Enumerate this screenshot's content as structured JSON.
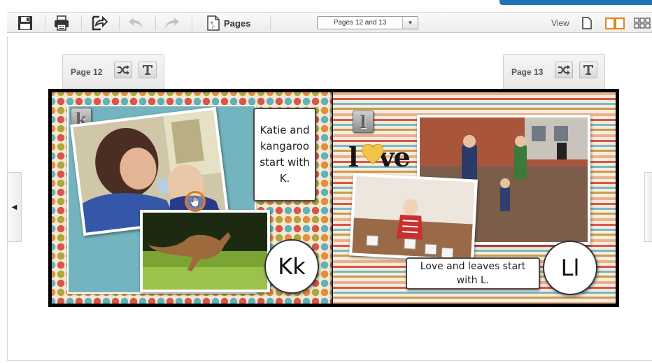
{
  "toolbar": {
    "pages_button_label": "Pages",
    "page_select_value": "Pages 12 and 13",
    "view_label": "View",
    "icons": [
      "save-icon",
      "print-icon",
      "share-icon",
      "undo-icon",
      "redo-icon",
      "pages-icon",
      "single-page-icon",
      "book-view-icon",
      "grid-view-icon"
    ]
  },
  "left_page": {
    "tab_label": "Page 12",
    "letter_tile": "k",
    "caption": "Katie and kangaroo start with K.",
    "badge": "Kk"
  },
  "right_page": {
    "tab_label": "Page 13",
    "letter_tile": "l",
    "title_word_first": "l",
    "title_word_rest": "ve",
    "caption": "Love and leaves start with L.",
    "badge": "Ll"
  },
  "nav": {
    "prev_glyph": "◀"
  },
  "colors": {
    "accent": "#1f73b7",
    "cursor": "#e07b23",
    "heart": "#f2c44a"
  }
}
